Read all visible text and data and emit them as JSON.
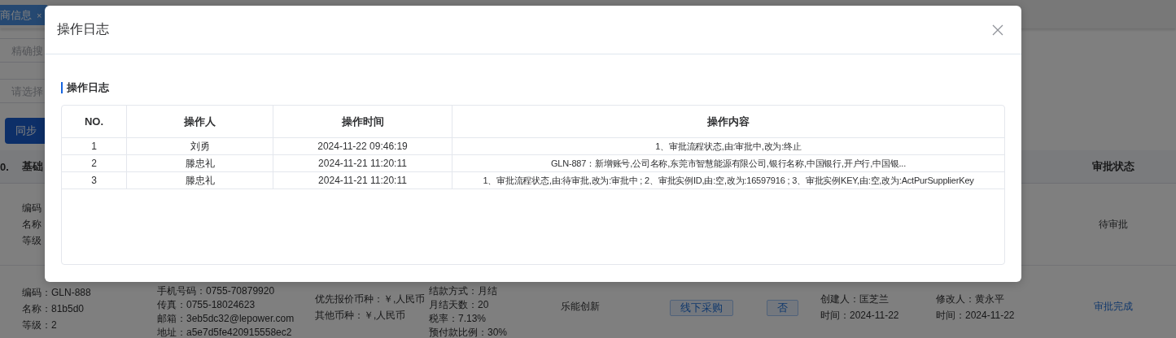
{
  "background": {
    "tab": {
      "label": "商信息",
      "close": "×"
    },
    "filters": [
      {
        "placeholder": "精确搜"
      },
      {
        "placeholder": "请选择"
      }
    ],
    "sync_button": "同步",
    "table": {
      "columns": [
        {
          "label": "0."
        },
        {
          "label": "基础"
        },
        {
          "label": "审批状态"
        }
      ],
      "rows": [
        {
          "basic": [
            "编码",
            "名称",
            "等级"
          ],
          "status": "待审批",
          "color": "#18191a"
        },
        {
          "basic": [
            "编码：GLN-888",
            "名称：81b5d0",
            "等级：2"
          ],
          "contact": [
            "手机号码：0755-70879920",
            "传真：0755-18024623",
            "邮箱：3eb5dc32@lepower.com",
            "地址：a5e7d5fe420915558ec2"
          ],
          "currency": [
            "优先报价币种：￥,人民币",
            "其他币种：￥,人民币"
          ],
          "settlement": [
            "结款方式：月结",
            "月结天数：20",
            "税率：7.13%",
            "预付款比例：30%"
          ],
          "brand": "乐能创新",
          "purchase_tag": "线下采购",
          "flag_tag": "否",
          "creator": [
            "创建人：匡芝兰",
            "时间：2024-11-22"
          ],
          "modifier": [
            "修改人：黄永平",
            "时间：2024-11-22"
          ],
          "status": "审批完成",
          "color": "#10386c"
        }
      ]
    }
  },
  "modal": {
    "title": "操作日志",
    "section_title": "操作日志",
    "table": {
      "columns": [
        "NO.",
        "操作人",
        "操作时间",
        "操作内容"
      ],
      "rows": [
        {
          "no": "1",
          "operator": "刘勇",
          "time": "2024-11-22 09:46:19",
          "content": "1、审批流程状态,由:审批中,改为:终止"
        },
        {
          "no": "2",
          "operator": "滕忠礼",
          "time": "2024-11-21 11:20:11",
          "content": "GLN-887：新增账号,公司名称,东莞市智慧能源有限公司,银行名称,中国银行,开户行,中国银..."
        },
        {
          "no": "3",
          "operator": "滕忠礼",
          "time": "2024-11-21 11:20:11",
          "content": "1、审批流程状态,由:待审批,改为:审批中 ; 2、审批实例ID,由:空,改为:16597916 ; 3、审批实例KEY,由:空,改为:ActPurSupplierKey"
        }
      ]
    }
  }
}
